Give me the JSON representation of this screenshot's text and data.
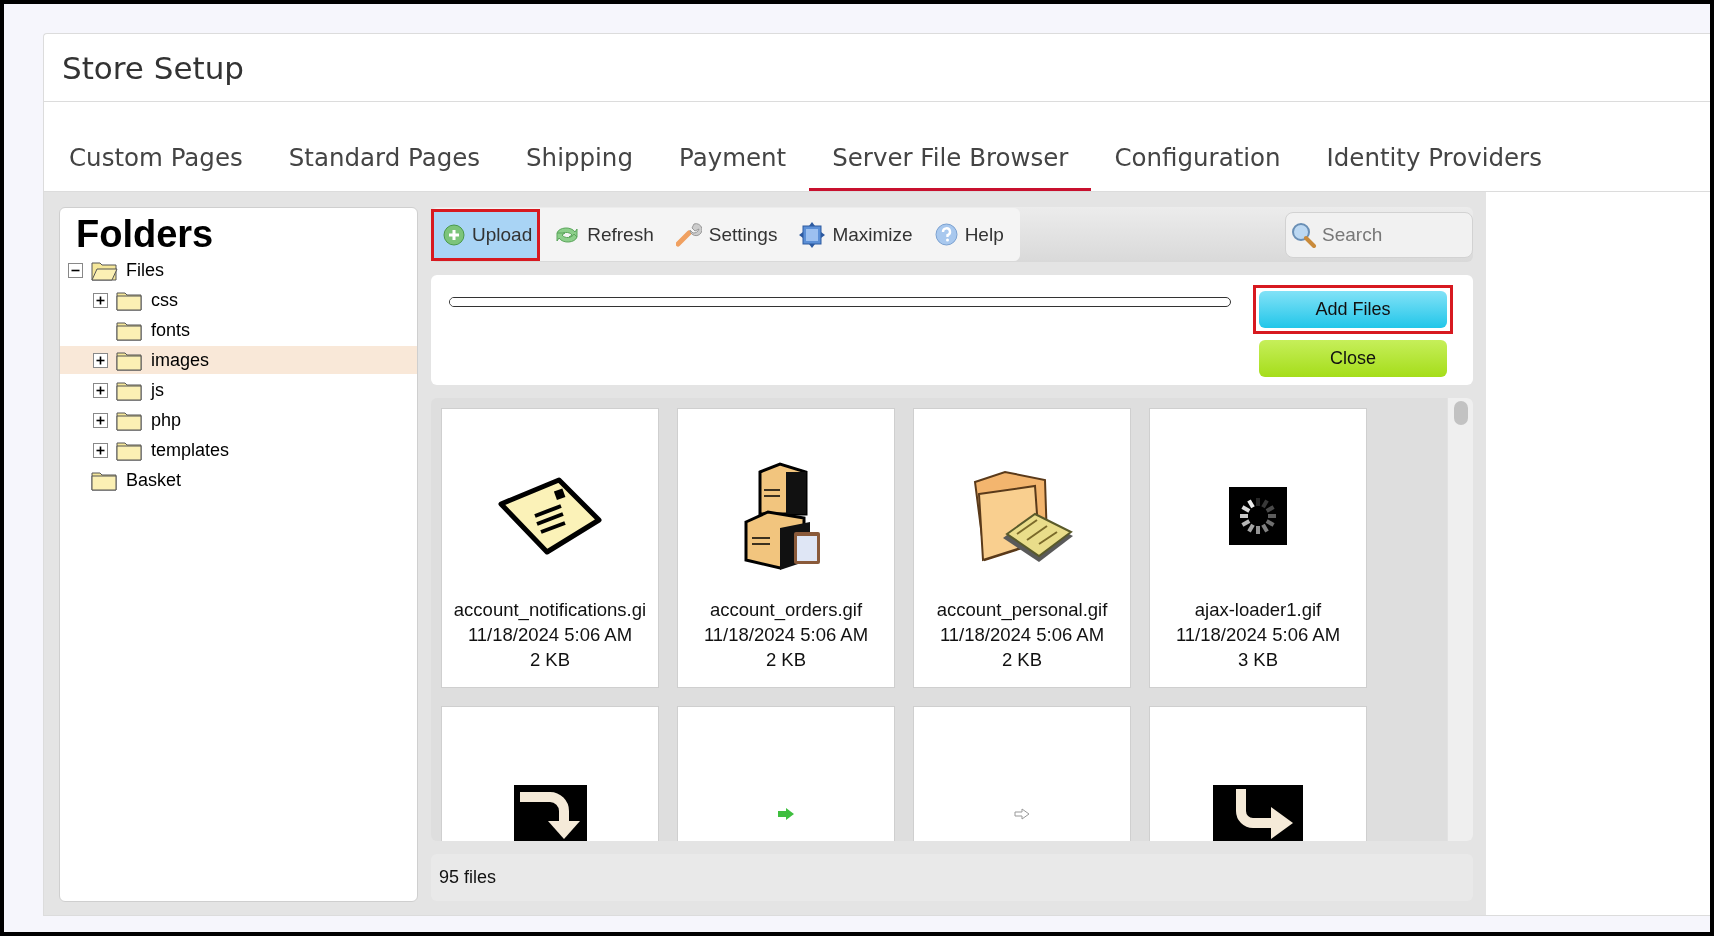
{
  "window": {
    "title": "Store Setup"
  },
  "tabs": [
    {
      "label": "Custom Pages",
      "selected": false
    },
    {
      "label": "Standard Pages",
      "selected": false
    },
    {
      "label": "Shipping",
      "selected": false
    },
    {
      "label": "Payment",
      "selected": false
    },
    {
      "label": "Server File Browser",
      "selected": true
    },
    {
      "label": "Configuration",
      "selected": false
    },
    {
      "label": "Identity Providers",
      "selected": false
    }
  ],
  "folders": {
    "title": "Folders",
    "items": [
      {
        "label": "Files",
        "has_children": true,
        "expanded": true,
        "selected": false,
        "children": [
          {
            "label": "css",
            "has_children": true,
            "expanded": false,
            "selected": false
          },
          {
            "label": "fonts",
            "has_children": false,
            "expanded": false,
            "selected": false
          },
          {
            "label": "images",
            "has_children": true,
            "expanded": false,
            "selected": true
          },
          {
            "label": "js",
            "has_children": true,
            "expanded": false,
            "selected": false
          },
          {
            "label": "php",
            "has_children": true,
            "expanded": false,
            "selected": false
          },
          {
            "label": "templates",
            "has_children": true,
            "expanded": false,
            "selected": false
          }
        ]
      },
      {
        "label": "Basket",
        "has_children": false,
        "expanded": false,
        "selected": false
      }
    ]
  },
  "toolbar": {
    "buttons": [
      {
        "kind": "upload",
        "label": "Upload",
        "selected": true,
        "highlighted": true
      },
      {
        "kind": "refresh",
        "label": "Refresh",
        "selected": false,
        "highlighted": false
      },
      {
        "kind": "settings",
        "label": "Settings",
        "selected": false,
        "highlighted": false
      },
      {
        "kind": "maximize",
        "label": "Maximize",
        "selected": false,
        "highlighted": false
      },
      {
        "kind": "help",
        "label": "Help",
        "selected": false,
        "highlighted": false
      }
    ],
    "search": {
      "placeholder": "Search"
    }
  },
  "upload_panel": {
    "progress": {
      "level": 0
    },
    "buttons": [
      {
        "kind": "add",
        "label": "Add Files",
        "highlighted": true
      },
      {
        "kind": "close",
        "label": "Close",
        "highlighted": false
      }
    ]
  },
  "files": [
    {
      "kind": "envelope",
      "name": "account_notifications.gi",
      "date": "11/18/2024 5:06 AM",
      "size": "2 KB"
    },
    {
      "kind": "boxes",
      "name": "account_orders.gif",
      "date": "11/18/2024 5:06 AM",
      "size": "2 KB"
    },
    {
      "kind": "folder-book",
      "name": "account_personal.gif",
      "date": "11/18/2024 5:06 AM",
      "size": "2 KB"
    },
    {
      "kind": "spinner",
      "name": "ajax-loader1.gif",
      "date": "11/18/2024 5:06 AM",
      "size": "3 KB"
    },
    {
      "kind": "turn-down-arrow"
    },
    {
      "kind": "small-green-arrow"
    },
    {
      "kind": "small-outline-arrow"
    },
    {
      "kind": "turn-right-arrow"
    }
  ],
  "status_bar": {
    "text": "95 files"
  }
}
